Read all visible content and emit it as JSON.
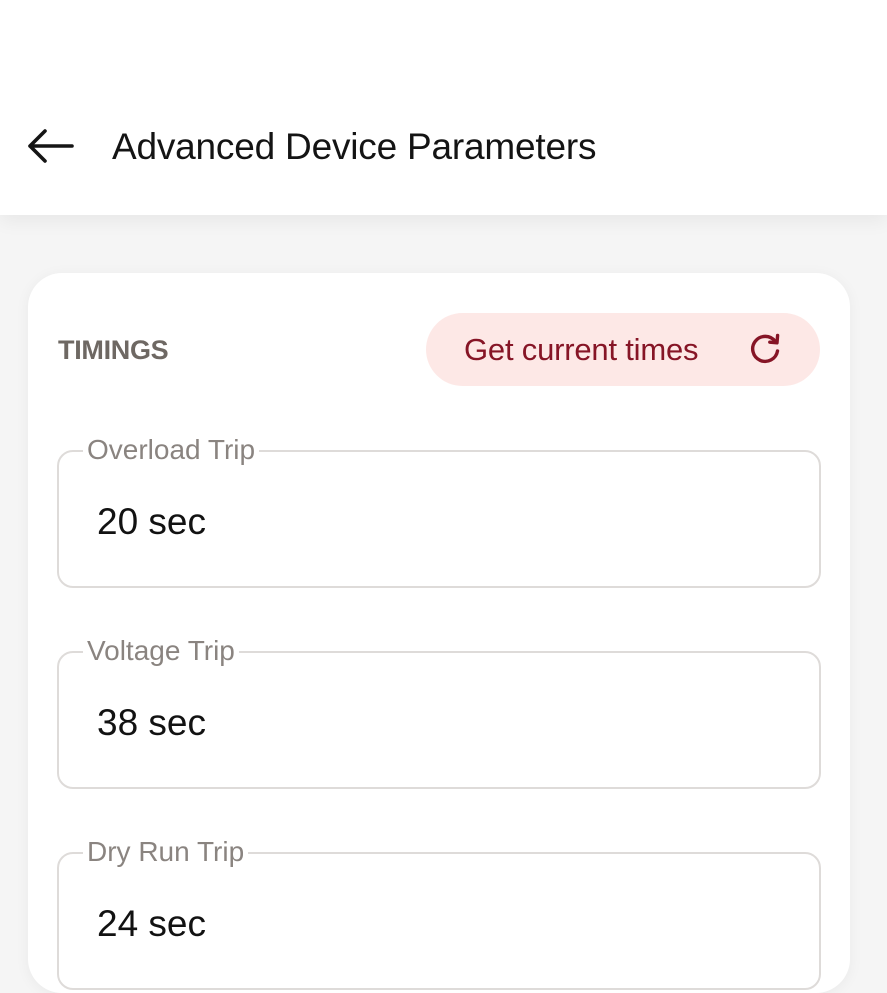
{
  "header": {
    "title": "Advanced Device Parameters",
    "back_icon": "arrow-left-icon"
  },
  "timings": {
    "section_label": "TIMINGS",
    "refresh_button_label": "Get current times",
    "refresh_icon": "refresh-icon",
    "accent_color": "#861526",
    "button_bg_color": "#fde8e6",
    "fields": [
      {
        "label": "Overload Trip",
        "value": "20 sec"
      },
      {
        "label": "Voltage Trip",
        "value": "38 sec"
      },
      {
        "label": "Dry Run Trip",
        "value": "24 sec"
      }
    ]
  }
}
